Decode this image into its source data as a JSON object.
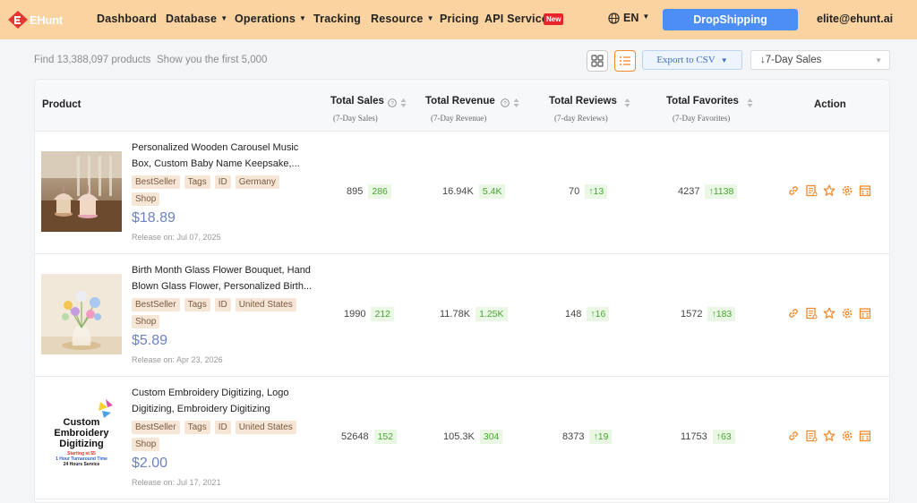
{
  "header": {
    "logo_text": "EHunt",
    "nav": [
      {
        "label": "Dashboard",
        "dropdown": false
      },
      {
        "label": "Database",
        "dropdown": true
      },
      {
        "label": "Operations",
        "dropdown": true
      },
      {
        "label": "Tracking",
        "dropdown": false
      },
      {
        "label": "Resource",
        "dropdown": true
      },
      {
        "label": "Pricing",
        "dropdown": false
      },
      {
        "label": "API Service",
        "dropdown": false
      }
    ],
    "new_badge": "New",
    "language": "EN",
    "cta": "DropShipping",
    "user_email": "elite@ehunt.ai",
    "colors": {
      "header_bg": "#fbd3a0",
      "cta_bg": "#4d8ef6",
      "badge_red": "#e6262b"
    }
  },
  "toolbar": {
    "found_text": "Find 13,388,097 products",
    "showing_text": "Show you the first 5,000",
    "grid_view_icon": "grid-view-icon",
    "list_view_icon": "list-view-icon",
    "export_label": "Export to CSV",
    "sort_value": "↓7-Day Sales"
  },
  "table": {
    "columns": {
      "product": "Product",
      "sales": "Total Sales",
      "sales_sub": "(7-Day Sales)",
      "revenue": "Total Revenue",
      "revenue_sub": "(7-Day Revenue)",
      "reviews": "Total Reviews",
      "reviews_sub": "(7-day Reviews)",
      "favorites": "Total Favorites",
      "favorites_sub": "(7-Day Favorites)",
      "action": "Action"
    },
    "rows": [
      {
        "title": "Personalized Wooden Carousel Music Box, Custom Baby Name Keepsake,...",
        "tags": [
          "BestSeller",
          "Tags",
          "ID",
          "Germany",
          "Shop"
        ],
        "price": "$18.89",
        "release": "Release on: Jul 07, 2025",
        "sales": "895",
        "sales_delta": "286",
        "revenue": "16.94K",
        "revenue_delta": "5.4K",
        "reviews": "70",
        "reviews_delta": "↑13",
        "favorites": "4237",
        "favorites_delta": "↑1138"
      },
      {
        "title": "Birth Month Glass Flower Bouquet, Hand Blown Glass Flower, Personalized Birth...",
        "tags": [
          "BestSeller",
          "Tags",
          "ID",
          "United States",
          "Shop"
        ],
        "price": "$5.89",
        "release": "Release on: Apr 23, 2026",
        "sales": "1990",
        "sales_delta": "212",
        "revenue": "11.78K",
        "revenue_delta": "1.25K",
        "reviews": "148",
        "reviews_delta": "↑16",
        "favorites": "1572",
        "favorites_delta": "↑183"
      },
      {
        "title": "Custom Embroidery Digitizing, Logo Digitizing, Embroidery Digitizing Service,...",
        "tags": [
          "BestSeller",
          "Tags",
          "ID",
          "United States",
          "Shop"
        ],
        "price": "$2.00",
        "release": "Release on: Jul 17, 2021",
        "sales": "52648",
        "sales_delta": "152",
        "revenue": "105.3K",
        "revenue_delta": "304",
        "reviews": "8373",
        "reviews_delta": "↑19",
        "favorites": "11753",
        "favorites_delta": "↑63",
        "thumb_text": {
          "line1": "Custom",
          "line2": "Embroidery",
          "line3": "Digitizing",
          "line4": "Starting at $5",
          "line5": "1 Hour Turnaround Time",
          "line6": "24 Hours Service"
        }
      }
    ],
    "action_icons": [
      "link-icon",
      "report-icon",
      "star-icon",
      "settings-icon",
      "calendar-icon"
    ],
    "colors": {
      "action_orange": "#f08a2e",
      "delta_green": "#45a830",
      "price_blue": "#6d82c0",
      "tag_bg": "#f6e6d6"
    }
  }
}
